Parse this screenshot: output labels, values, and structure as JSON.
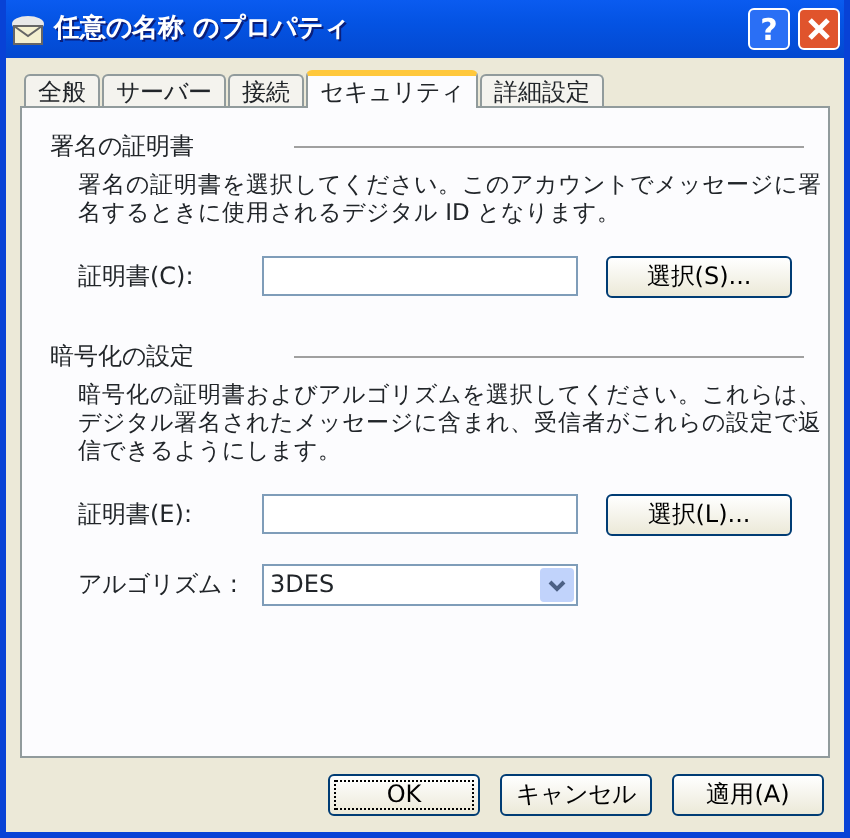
{
  "window": {
    "title": "任意の名称 のプロパティ",
    "help_button": "?"
  },
  "tabs": [
    {
      "label": "全般",
      "selected": false
    },
    {
      "label": "サーバー",
      "selected": false
    },
    {
      "label": "接続",
      "selected": false
    },
    {
      "label": "セキュリティ",
      "selected": true
    },
    {
      "label": "詳細設定",
      "selected": false
    }
  ],
  "sections": [
    {
      "heading": "署名の証明書",
      "description": "署名の証明書を選択してください。このアカウントでメッセージに署名するときに使用されるデジタル ID となります。",
      "fields": [
        {
          "kind": "certificate",
          "label": "証明書(C):",
          "button": "選択(S)..."
        }
      ]
    },
    {
      "heading": "暗号化の設定",
      "description": "暗号化の証明書およびアルゴリズムを選択してください。これらは、デジタル署名されたメッセージに含まれ、受信者がこれらの設定で返信できるようにします。",
      "fields": [
        {
          "kind": "certificate",
          "label": "証明書(E):",
          "button": "選択(L)..."
        },
        {
          "kind": "select",
          "label": "アルゴリズム :",
          "value": "3DES"
        }
      ]
    }
  ],
  "buttons": [
    {
      "label": "OK",
      "focused": true
    },
    {
      "label": "キャンセル",
      "focused": false
    },
    {
      "label": "適用(A)",
      "focused": false
    }
  ]
}
